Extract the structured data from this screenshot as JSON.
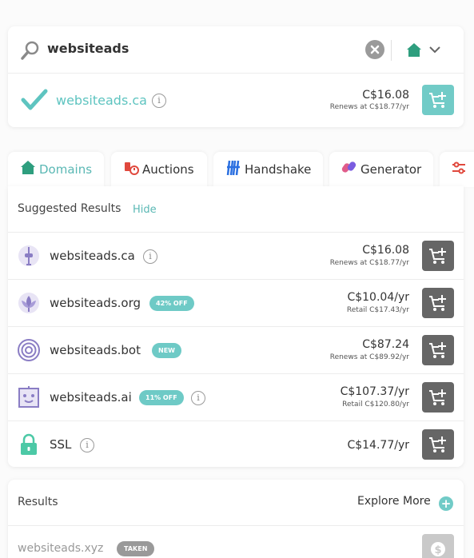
{
  "search": {
    "query": "websiteads"
  },
  "exact_match": {
    "domain": "websiteads.ca",
    "price": "C$16.08",
    "renews": "Renews at C$18.77/yr"
  },
  "tabs": [
    {
      "label": "Domains",
      "active": true
    },
    {
      "label": "Auctions",
      "active": false
    },
    {
      "label": "Handshake",
      "active": false
    },
    {
      "label": "Generator",
      "active": false
    }
  ],
  "suggested": {
    "title": "Suggested Results",
    "hide_label": "Hide",
    "rows": [
      {
        "domain": "websiteads.ca",
        "badge": "",
        "price": "C$16.08",
        "sub": "Renews at C$18.77/yr",
        "icon": "ca-tower-icon"
      },
      {
        "domain": "websiteads.org",
        "badge": "42% OFF",
        "price": "C$10.04/yr",
        "sub": "Retail C$17.43/yr",
        "icon": "lotus-icon"
      },
      {
        "domain": "websiteads.bot",
        "badge": "NEW",
        "price": "C$87.24",
        "sub": "Renews at C$89.92/yr",
        "icon": "target-icon"
      },
      {
        "domain": "websiteads.ai",
        "badge": "11% OFF",
        "price": "C$107.37/yr",
        "sub": "Retail C$120.80/yr",
        "icon": "robot-icon"
      },
      {
        "domain": "SSL",
        "badge": "",
        "price": "C$14.77/yr",
        "sub": "",
        "icon": "lock-icon"
      }
    ]
  },
  "results": {
    "title": "Results",
    "explore_label": "Explore More",
    "rows": [
      {
        "domain": "websiteads.xyz",
        "badge": "TAKEN"
      }
    ]
  },
  "info_glyph": "i",
  "explore_glyph": "+",
  "colors": {
    "accent": "#5ab8b4",
    "cart_teal": "#71cbc7",
    "cart_dark": "#666666",
    "auctions_red": "#e0483d",
    "handshake_blue": "#2a6fe0"
  }
}
